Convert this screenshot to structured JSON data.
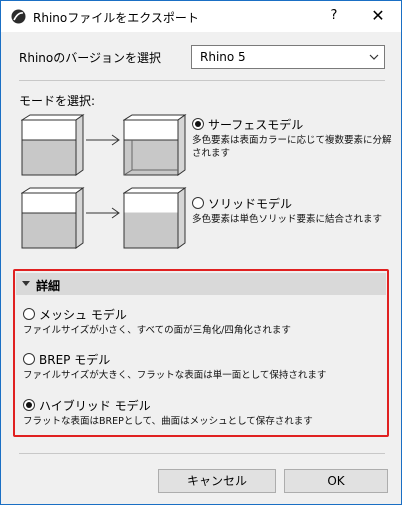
{
  "titlebar": {
    "title": "Rhinoファイルをエクスポート",
    "help": "?",
    "close": "✕"
  },
  "version": {
    "label": "Rhinoのバージョンを選択",
    "selected": "Rhino 5"
  },
  "mode": {
    "label": "モードを選択:",
    "surface": {
      "label": "サーフェスモデル",
      "desc1": "多色要素は表面カラーに応じて複数要素に分解",
      "desc2": "されます",
      "selected": true
    },
    "solid": {
      "label": "ソリッドモデル",
      "desc1": "多色要素は単色ソリッド要素に結合されます",
      "selected": false
    }
  },
  "details": {
    "header": "詳細",
    "mesh": {
      "label": "メッシュ モデル",
      "desc": "ファイルサイズが小さく、すべての面が三角化/四角化されます",
      "selected": false
    },
    "brep": {
      "label": "BREP モデル",
      "desc": "ファイルサイズが大きく、フラットな表面は単一面として保持されます",
      "selected": false
    },
    "hybrid": {
      "label": "ハイブリッド モデル",
      "desc": "フラットな表面はBREPとして、曲面はメッシュとして保存されます",
      "selected": true
    }
  },
  "buttons": {
    "cancel": "キャンセル",
    "ok": "OK"
  }
}
